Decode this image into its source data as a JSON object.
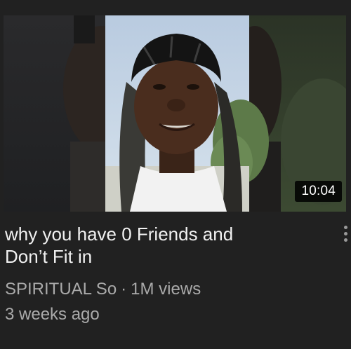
{
  "video": {
    "duration": "10:04",
    "title_line1": "why you have 0 Friends and",
    "title_line2": "Don’t Fit in",
    "channel": "SPIRITUAL So",
    "separator": "·",
    "views": "1M views",
    "age": "3 weeks ago"
  },
  "icons": {
    "more": "more-vert-icon"
  },
  "colors": {
    "background": "#212121",
    "title": "#f1f1f1",
    "meta": "#aaaaaa",
    "duration_bg": "#000000"
  }
}
